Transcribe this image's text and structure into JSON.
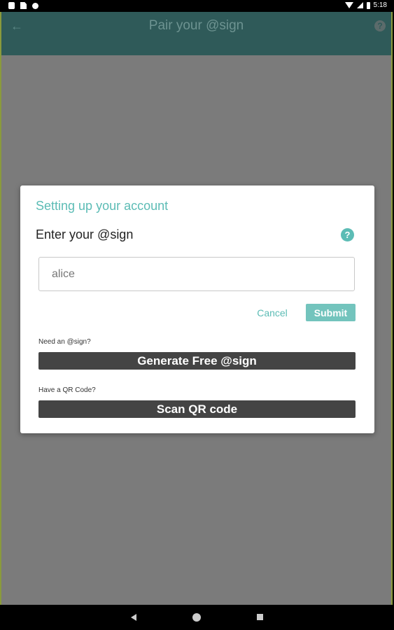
{
  "status_bar": {
    "time": "5:18",
    "icons": [
      "notification-icon",
      "sim-icon",
      "circle-icon",
      "wifi-icon",
      "signal-icon",
      "battery-icon"
    ]
  },
  "app_bar": {
    "title": "Pair your @sign",
    "back_icon": "arrow-left-icon",
    "help_icon": "help-icon",
    "help_glyph": "?"
  },
  "dialog": {
    "title": "Setting up your account",
    "subtitle": "Enter your @sign",
    "help_glyph": "?",
    "input_value": "alice",
    "cancel_label": "Cancel",
    "submit_label": "Submit",
    "need_sign_label": "Need an @sign?",
    "generate_label": "Generate Free @sign",
    "have_qr_label": "Have a QR Code?",
    "scan_label": "Scan QR code"
  },
  "colors": {
    "accent": "#5cbcb5",
    "app_bar": "#2f5a59",
    "overlay": "#7b7b7b",
    "dark_button": "#444444"
  },
  "nav_bar": {
    "icons": [
      "back-triangle-icon",
      "home-circle-icon",
      "recents-square-icon"
    ]
  }
}
